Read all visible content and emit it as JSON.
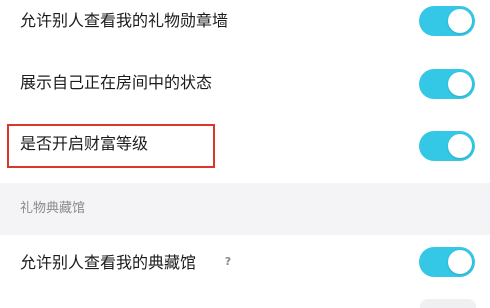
{
  "settings": [
    {
      "label": "允许别人查看我的礼物勋章墙",
      "enabled": true
    },
    {
      "label": "展示自己正在房间中的状态",
      "enabled": true
    },
    {
      "label": "是否开启财富等级",
      "enabled": true
    }
  ],
  "section": {
    "title": "礼物典藏馆",
    "items": [
      {
        "label": "允许别人查看我的典藏馆",
        "help_icon": "?",
        "enabled": true
      }
    ]
  },
  "colors": {
    "toggle_on": "#34c8e6",
    "highlight": "#d9362c",
    "section_background": "#f4f4f6"
  },
  "icons": {
    "help": "question-mark-icon"
  }
}
